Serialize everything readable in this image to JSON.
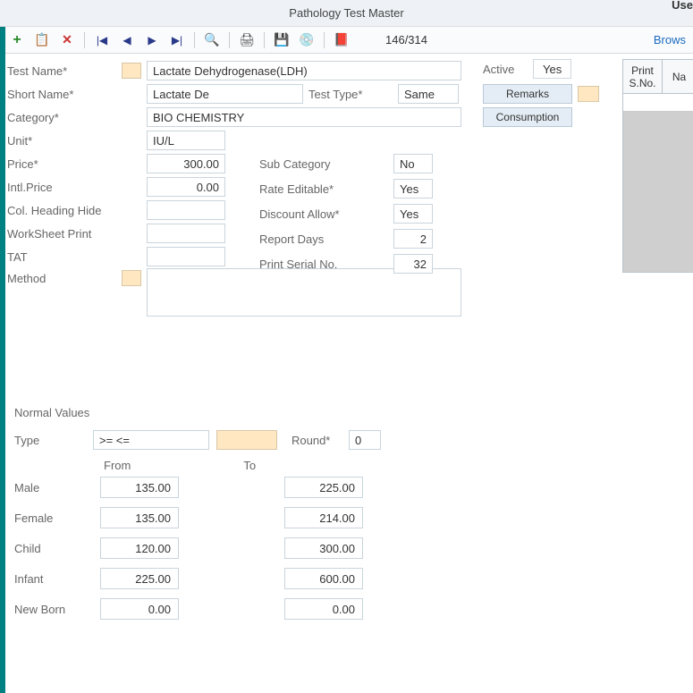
{
  "title": "Pathology Test Master",
  "user_label": "Use",
  "toolbar": {
    "counter": "146/314",
    "browse": "Brows"
  },
  "form": {
    "test_name_label": "Test Name*",
    "test_name": "Lactate Dehydrogenase(LDH)",
    "short_name_label": "Short Name*",
    "short_name": "Lactate De",
    "test_type_label": "Test Type*",
    "test_type": "Same",
    "category_label": "Category*",
    "category": "BIO CHEMISTRY",
    "unit_label": "Unit*",
    "unit": "IU/L",
    "price_label": "Price*",
    "price": "300.00",
    "intl_price_label": "Intl.Price",
    "intl_price": "0.00",
    "col_heading_label": "Col. Heading Hide",
    "col_heading": "",
    "worksheet_label": "WorkSheet Print",
    "worksheet": "",
    "tat_label": "TAT",
    "tat": "",
    "method_label": "Method",
    "method": "",
    "sub_category_label": "Sub Category",
    "sub_category": "No",
    "rate_editable_label": "Rate Editable*",
    "rate_editable": "Yes",
    "discount_allow_label": "Discount Allow*",
    "discount_allow": "Yes",
    "report_days_label": "Report Days",
    "report_days": "2",
    "print_serial_label": "Print Serial No.",
    "print_serial": "32"
  },
  "right": {
    "active_label": "Active",
    "active": "Yes",
    "remarks": "Remarks",
    "consumption": "Consumption"
  },
  "side_table": {
    "col1": "Print S.No.",
    "col2": "Na"
  },
  "normal": {
    "title": "Normal Values",
    "type_label": "Type",
    "type_value": ">= <=",
    "round_label": "Round*",
    "round_value": "0",
    "from_label": "From",
    "to_label": "To",
    "rows": [
      {
        "label": "Male",
        "from": "135.00",
        "to": "225.00"
      },
      {
        "label": "Female",
        "from": "135.00",
        "to": "214.00"
      },
      {
        "label": "Child",
        "from": "120.00",
        "to": "300.00"
      },
      {
        "label": "Infant",
        "from": "225.00",
        "to": "600.00"
      },
      {
        "label": "New Born",
        "from": "0.00",
        "to": "0.00"
      }
    ]
  }
}
